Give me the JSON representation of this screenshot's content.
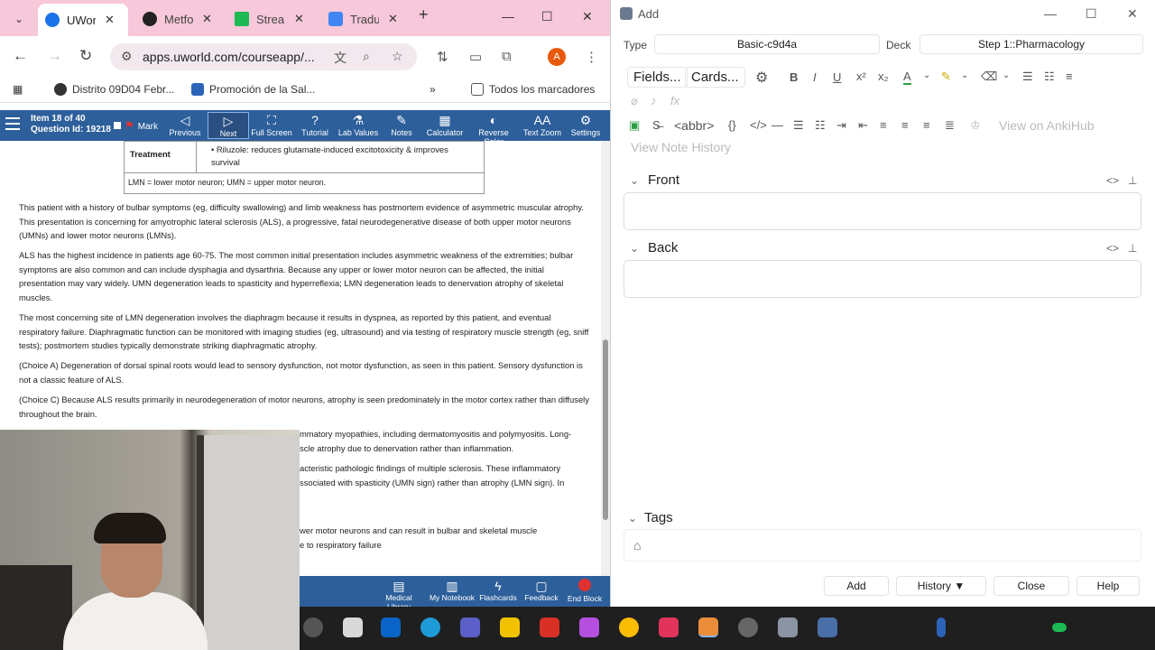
{
  "browser": {
    "tabs": [
      {
        "title": "UWorl",
        "color": "#1a73e8"
      },
      {
        "title": "Metfo",
        "color": "#222222"
      },
      {
        "title": "Strean",
        "color": "#1db954"
      },
      {
        "title": "Tradu",
        "color": "#4285f4"
      }
    ],
    "url": "apps.uworld.com/courseapp/...",
    "avatar_letter": "A",
    "bookmarks": [
      {
        "label": "Distrito 09D04 Febr..."
      },
      {
        "label": "Promoción de la Sal..."
      },
      {
        "label": "Todos los marcadores"
      }
    ]
  },
  "uworld": {
    "item": "Item 18 of 40",
    "question_id": "Question Id: 19218",
    "mark": "Mark",
    "buttons": [
      "Previous",
      "Next",
      "Full Screen",
      "Tutorial",
      "Lab Values",
      "Notes",
      "Calculator",
      "Reverse Color",
      "Text Zoom",
      "Settings"
    ],
    "table": {
      "row_label": "Treatment",
      "row_text": "Riluzole: reduces glutamate-induced excitotoxicity & improves survival",
      "footnote": "LMN = lower motor neuron; UMN = upper motor neuron."
    },
    "paragraphs": [
      "This patient with a history of bulbar symptoms (eg, difficulty swallowing) and limb weakness has postmortem evidence of asymmetric muscular atrophy. This presentation is concerning for amyotrophic lateral sclerosis (ALS), a progressive, fatal neurodegenerative disease of both upper motor neurons (UMNs) and lower motor neurons (LMNs).",
      "ALS has the highest incidence in patients age 60-75. The most common initial presentation includes asymmetric weakness of the extremities; bulbar symptoms are also common and can include dysphagia and dysarthria. Because any upper or lower motor neuron can be affected, the initial presentation may vary widely. UMN degeneration leads to spasticity and hyperreflexia; LMN degeneration leads to denervation atrophy of skeletal muscles.",
      "The most concerning site of LMN degeneration involves the diaphragm because it results in dyspnea, as reported by this patient, and eventual respiratory failure. Diaphragmatic function can be monitored with imaging studies (eg, ultrasound) and via testing of respiratory muscle strength (eg, sniff tests); postmortem studies typically demonstrate striking diaphragmatic atrophy.",
      "(Choice A) Degeneration of dorsal spinal roots would lead to sensory dysfunction, not motor dysfunction, as seen in this patient. Sensory dysfunction is not a classic feature of ALS.",
      "(Choice C) Because ALS results primarily in neurodegeneration of motor neurons, atrophy is seen predominately in the motor cortex rather than diffusely throughout the brain."
    ],
    "partial": [
      "mmatory myopathies, including dermatomyositis and polymyositis. Long-",
      "scle atrophy due to denervation rather than inflammation.",
      "acteristic pathologic findings of multiple sclerosis. These inflammatory",
      "ssociated with spasticity (UMN sign) rather than atrophy (LMN sign). In",
      "wer motor neurons and can result in bulbar and skeletal muscle",
      "e to respiratory failure"
    ],
    "bottom": [
      "Medical Library",
      "My Notebook",
      "Flashcards",
      "Feedback",
      "End Block"
    ]
  },
  "anki": {
    "title": "Add",
    "type_label": "Type",
    "type_value": "Basic-c9d4a",
    "deck_label": "Deck",
    "deck_value": "Step 1::Pharmacology",
    "fields_btn": "Fields...",
    "cards_btn": "Cards...",
    "abbr": "<abbr>",
    "ankihub": "View on AnkiHub",
    "history_link": "View Note History",
    "front": "Front",
    "back": "Back",
    "tags": "Tags",
    "buttons": {
      "add": "Add",
      "history": "History ▼",
      "close": "Close",
      "help": "Help"
    }
  }
}
